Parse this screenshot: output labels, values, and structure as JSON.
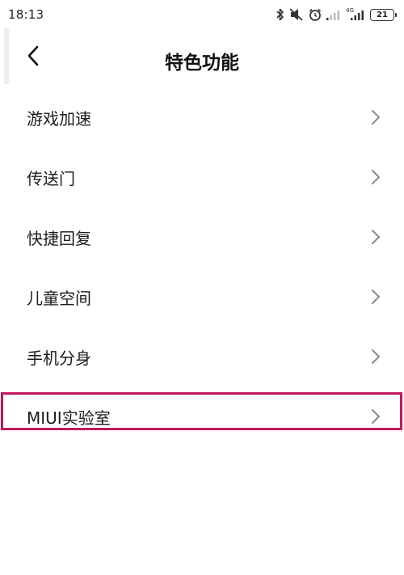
{
  "status_bar": {
    "time": "18:13",
    "network_label": "4G",
    "battery_level": "21",
    "icons": [
      "bluetooth-icon",
      "mute-icon",
      "alarm-icon",
      "signal-icon",
      "signal-4g-icon",
      "battery-icon"
    ]
  },
  "header": {
    "title": "特色功能",
    "back_icon": "back-chevron-icon"
  },
  "list": {
    "items": [
      {
        "label": "游戏加速"
      },
      {
        "label": "传送门"
      },
      {
        "label": "快捷回复"
      },
      {
        "label": "儿童空间"
      },
      {
        "label": "手机分身"
      },
      {
        "label": "MIUI实验室",
        "highlighted": true
      }
    ],
    "chevron_icon": "chevron-right-icon"
  },
  "colors": {
    "highlight": "#c2185b",
    "chevron": "#8a8a8a"
  }
}
